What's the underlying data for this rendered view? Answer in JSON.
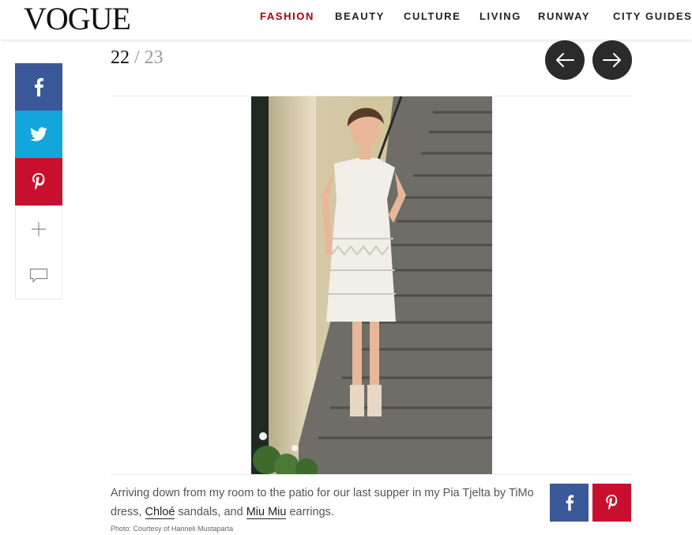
{
  "header": {
    "logo": "VOGUE",
    "nav": [
      {
        "label": "FASHION",
        "active": true
      },
      {
        "label": "BEAUTY",
        "active": false
      },
      {
        "label": "CULTURE",
        "active": false
      },
      {
        "label": "LIVING",
        "active": false
      },
      {
        "label": "RUNWAY",
        "active": false
      },
      {
        "label": "CITY GUIDES",
        "active": false
      }
    ],
    "active_color": "#a5000f"
  },
  "share": {
    "items": [
      {
        "icon": "facebook-icon",
        "color": "#3b5998"
      },
      {
        "icon": "twitter-icon",
        "color": "#12a6dd"
      },
      {
        "icon": "pinterest-icon",
        "color": "#c8102e"
      },
      {
        "icon": "plus-icon"
      },
      {
        "icon": "comment-icon"
      }
    ]
  },
  "slideshow": {
    "current": "22",
    "separator": "/",
    "total": "23",
    "prev_icon": "arrow-left-icon",
    "next_icon": "arrow-right-icon"
  },
  "caption": {
    "text_1": "Arriving down from my room to the patio for our last supper in my Pia Tjelta by TiMo dress, ",
    "link_1": "Chloé",
    "text_2": " sandals, and ",
    "link_2": "Miu Miu",
    "text_3": " earrings.",
    "credit": "Photo: Courtesy of Hanneli Mustaparta"
  }
}
